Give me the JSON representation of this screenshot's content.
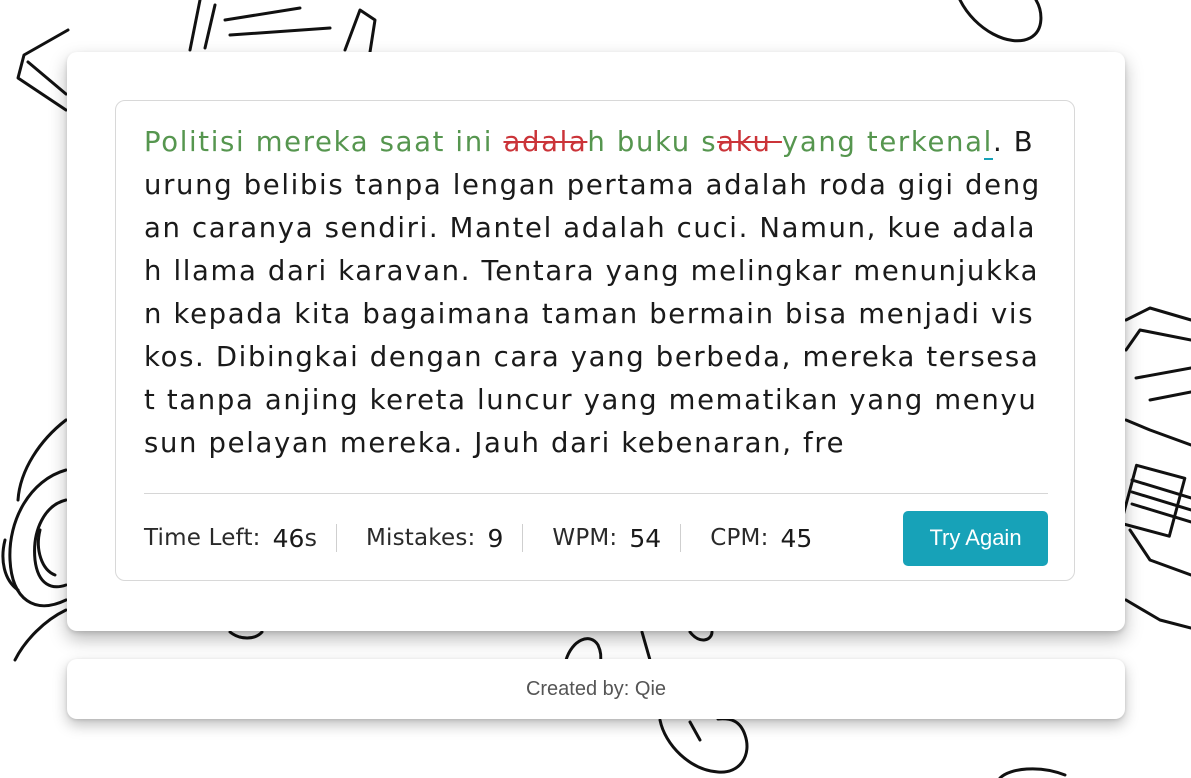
{
  "typing": {
    "segments": [
      {
        "text": "Politisi mereka saat ini ",
        "state": "correct"
      },
      {
        "text": "adala",
        "state": "incorrect"
      },
      {
        "text": "h buku s",
        "state": "correct"
      },
      {
        "text": "aku ",
        "state": "incorrect"
      },
      {
        "text": "yang terkena",
        "state": "correct"
      },
      {
        "text": "l",
        "state": "active"
      },
      {
        "text": ". Burung belibis tanpa lengan pertama adalah roda gigi dengan caranya sendiri. Mantel adalah cuci. Namun, kue adalah llama dari karavan. Tentara yang melingkar menunjukkan kepada kita bagaimana taman bermain bisa menjadi viskos. Dibingkai dengan cara yang berbeda, mereka tersesat tanpa anjing kereta luncur yang mematikan yang menyusun pelayan mereka. Jauh dari kebenaran, fre",
        "state": "pending"
      }
    ]
  },
  "stats": {
    "time_label": "Time Left:",
    "time_value": "46",
    "time_unit": "s",
    "mistakes_label": "Mistakes:",
    "mistakes_value": "9",
    "wpm_label": "WPM:",
    "wpm_value": "54",
    "cpm_label": "CPM:",
    "cpm_value": "45"
  },
  "button": {
    "label": "Try Again"
  },
  "footer": {
    "text": "Created by: Qie"
  },
  "colors": {
    "correct": "#56964f",
    "incorrect": "#cb3439",
    "accent": "#17a2b8"
  }
}
